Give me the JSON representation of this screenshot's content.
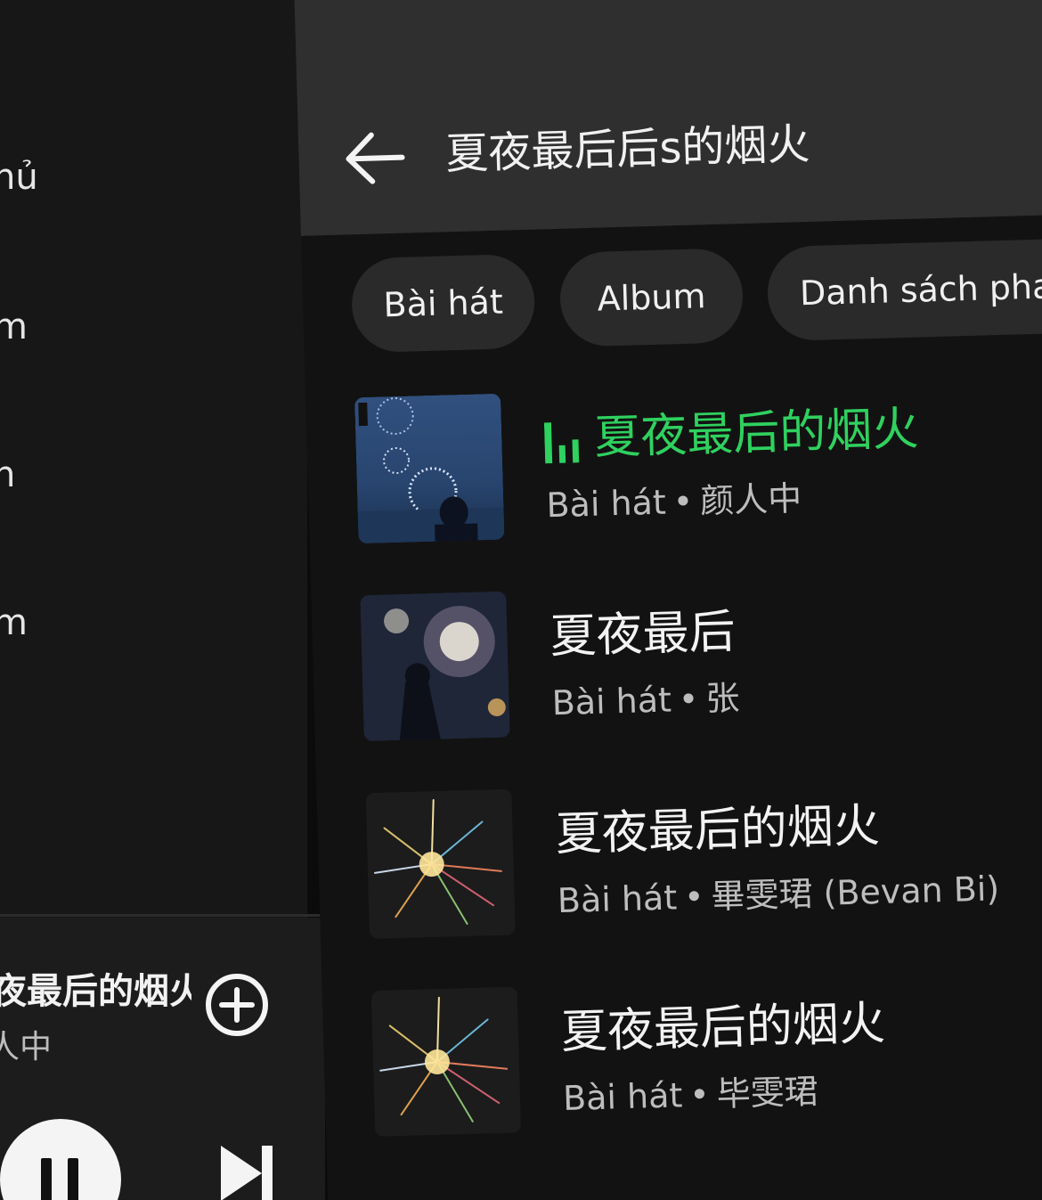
{
  "sidebar": {
    "items": [
      {
        "label": "hủ"
      },
      {
        "label": "m"
      },
      {
        "label": "n"
      },
      {
        "label": "m"
      }
    ]
  },
  "now_playing": {
    "title": "夜最后的烟火",
    "artist": "人中"
  },
  "search": {
    "query": "夏夜最后后s的烟火"
  },
  "filters": [
    {
      "label": "Bài hát"
    },
    {
      "label": "Album"
    },
    {
      "label": "Danh sách pha"
    }
  ],
  "results": [
    {
      "title": "夏夜最后的烟火",
      "type": "Bài hát",
      "separator": "•",
      "artist": "颜人中",
      "playing": true
    },
    {
      "title": "夏夜最后",
      "type": "Bài hát",
      "separator": "•",
      "artist": "张"
    },
    {
      "title": "夏夜最后的烟火",
      "type": "Bài hát",
      "separator": "•",
      "artist": "畢雯珺 (Bevan Bi)"
    },
    {
      "title": "夏夜最后的烟火",
      "type": "Bài hát",
      "separator": "•",
      "artist": "毕雯珺"
    }
  ],
  "colors": {
    "accent_green": "#2fd15f",
    "header_bg": "#2f2f2f",
    "chip_bg": "#2a2a2a",
    "sidebar_bg": "#171717"
  },
  "icons": {
    "back": "arrow-left-icon",
    "add": "plus-circle-icon",
    "pause": "pause-icon",
    "next": "skip-next-icon",
    "playing": "equalizer-icon"
  }
}
